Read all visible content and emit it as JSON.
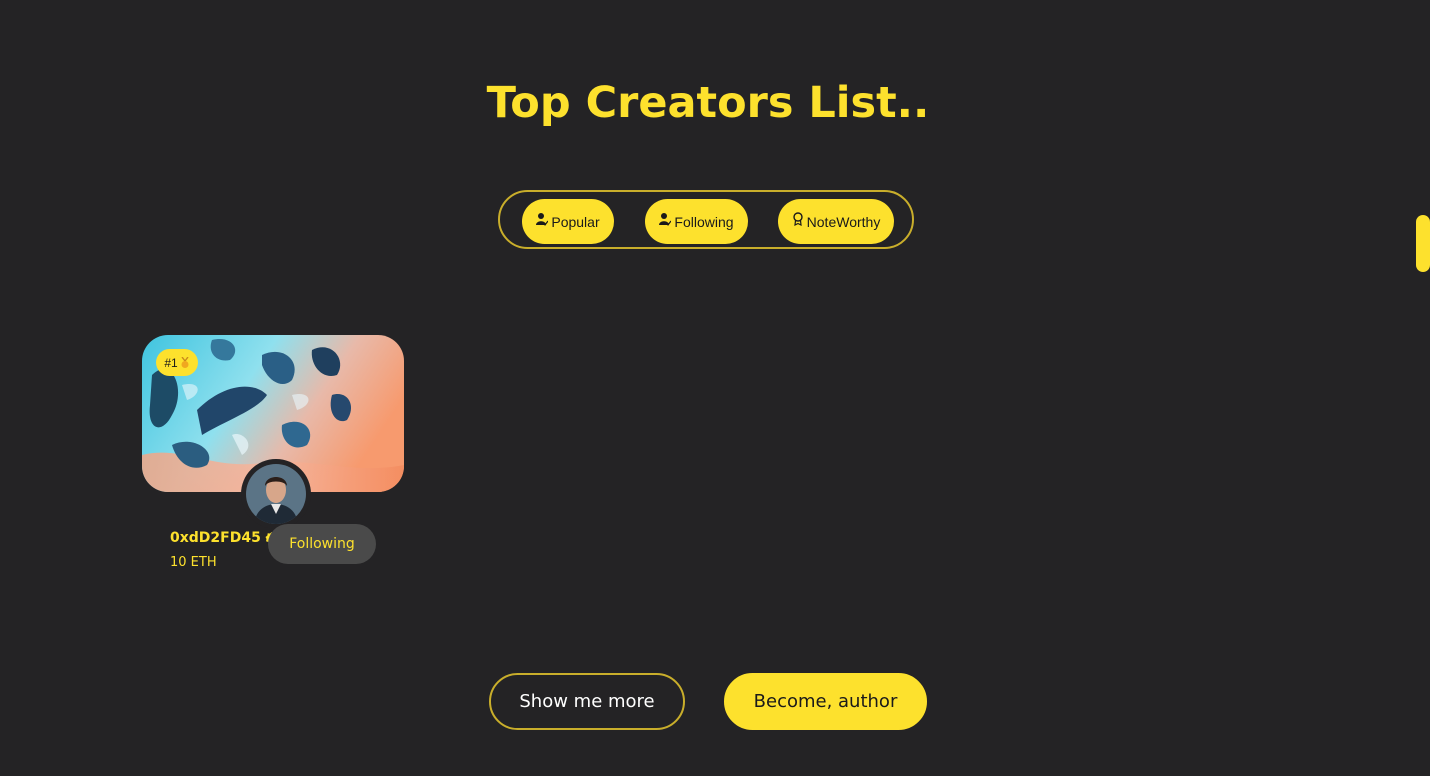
{
  "section": {
    "title": "Top Creators List.."
  },
  "filters": [
    {
      "label": "Popular",
      "icon": "user-check-icon"
    },
    {
      "label": "Following",
      "icon": "user-check-icon"
    },
    {
      "label": "NoteWorthy",
      "icon": "award-icon"
    }
  ],
  "creators": [
    {
      "rank": "#1",
      "rank_icon": "medal-icon",
      "name": "0xdD2FD45",
      "verified_icon": "verified-badge-icon",
      "eth": "10 ETH",
      "follow_label": "Following"
    }
  ],
  "actions": {
    "more_label": "Show me more",
    "author_label": "Become, author"
  },
  "colors": {
    "background": "#242325",
    "accent": "#fde12d",
    "muted_button": "#4a4a4a"
  }
}
